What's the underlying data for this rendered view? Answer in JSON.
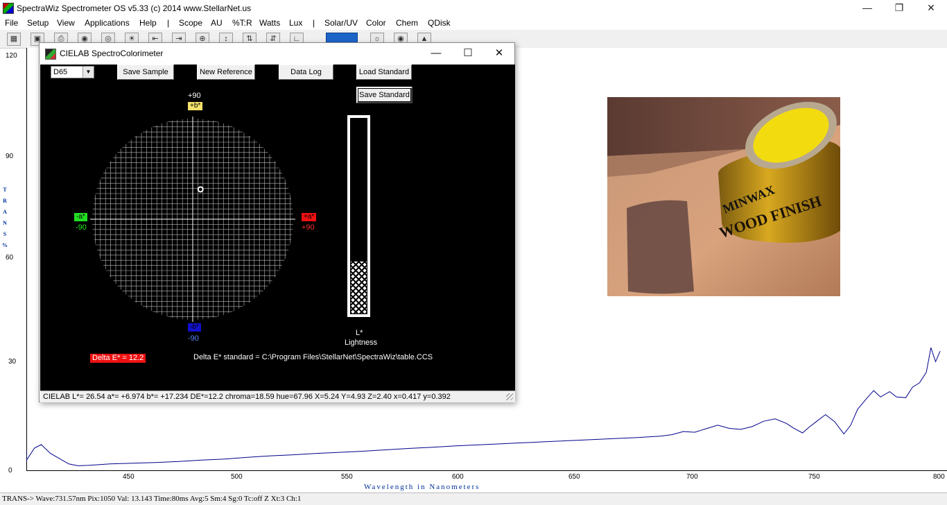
{
  "window": {
    "title": "SpectraWiz  Spectrometer OS v5.33 (c) 2014    www.StellarNet.us"
  },
  "menu": [
    "File",
    "Setup",
    "View",
    "Applications",
    "Help",
    "|",
    "Scope",
    "AU",
    "%T:R",
    "Watts",
    "Lux",
    "|",
    "Solar/UV",
    "Color",
    "Chem",
    "QDisk"
  ],
  "plot": {
    "y_ticks": [
      "120",
      "90",
      "60",
      "30",
      "0"
    ],
    "x_ticks": [
      "450",
      "500",
      "550",
      "600",
      "650",
      "700",
      "750",
      "800"
    ],
    "y_label_letters": [
      "T",
      "R",
      "A",
      "N",
      "S",
      "%"
    ],
    "x_label": "Wavelength  in  Nanometers",
    "line_color": "#00008b",
    "series": [
      [
        400,
        6
      ],
      [
        403,
        3
      ],
      [
        407,
        6.5
      ],
      [
        410,
        7.5
      ],
      [
        414,
        5
      ],
      [
        418,
        3.5
      ],
      [
        422,
        2
      ],
      [
        426,
        1.5
      ],
      [
        430,
        1.6
      ],
      [
        440,
        2
      ],
      [
        450,
        2.2
      ],
      [
        460,
        2.4
      ],
      [
        470,
        2.7
      ],
      [
        480,
        3.1
      ],
      [
        490,
        3.4
      ],
      [
        500,
        3.9
      ],
      [
        510,
        4.3
      ],
      [
        520,
        4.6
      ],
      [
        530,
        5
      ],
      [
        540,
        5.3
      ],
      [
        550,
        5.6
      ],
      [
        560,
        6
      ],
      [
        570,
        6.4
      ],
      [
        580,
        6.7
      ],
      [
        590,
        7.1
      ],
      [
        600,
        7.4
      ],
      [
        610,
        7.7
      ],
      [
        620,
        8
      ],
      [
        630,
        8.3
      ],
      [
        640,
        8.6
      ],
      [
        650,
        8.9
      ],
      [
        660,
        9.2
      ],
      [
        670,
        9.5
      ],
      [
        680,
        9.9
      ],
      [
        685,
        10.3
      ],
      [
        690,
        11.2
      ],
      [
        695,
        11
      ],
      [
        700,
        12
      ],
      [
        705,
        13
      ],
      [
        710,
        12.1
      ],
      [
        715,
        11.8
      ],
      [
        720,
        12.6
      ],
      [
        725,
        14.1
      ],
      [
        730,
        14.8
      ],
      [
        735,
        13.5
      ],
      [
        738,
        12.2
      ],
      [
        742,
        10.8
      ],
      [
        745,
        12.5
      ],
      [
        748,
        14
      ],
      [
        752,
        16
      ],
      [
        756,
        14
      ],
      [
        760,
        10.5
      ],
      [
        763,
        13
      ],
      [
        766,
        17.5
      ],
      [
        770,
        20.6
      ],
      [
        773,
        22.8
      ],
      [
        776,
        21
      ],
      [
        780,
        22.5
      ],
      [
        783,
        21
      ],
      [
        787,
        20.8
      ],
      [
        790,
        23.8
      ],
      [
        793,
        25
      ],
      [
        796,
        28
      ],
      [
        798,
        35
      ],
      [
        800,
        31
      ],
      [
        802,
        34
      ]
    ]
  },
  "status_bar": "TRANS->  Wave:731.57nm  Pix:1050  Val: 13.143  Time:80ms  Avg:5  Sm:4  Sg:0  Tc:off  Z  Xt:3  Ch:1",
  "dialog": {
    "title": "CIELAB SpectroColorimeter",
    "illuminant": "D65",
    "buttons": {
      "save_sample": "Save Sample",
      "new_reference": "New Reference",
      "data_log": "Data Log",
      "load_standard": "Load Standard",
      "save_standard": "Save Standard"
    },
    "axis_labels": {
      "plus_b_value": "+90",
      "plus_b": "+b*",
      "minus_a": "-a*",
      "minus_a_value": "-90",
      "plus_a": "+a*",
      "plus_a_value": "+90",
      "minus_b": "-b*",
      "minus_b_value": "-90"
    },
    "lightness_label_1": "L*",
    "lightness_label_2": "Lightness",
    "lightness_value": 26.54,
    "a_value": 6.974,
    "b_value": 17.234,
    "delta_e_badge": "Delta E* = 12.2",
    "delta_e_standard": "Delta E* standard = C:\\Program Files\\StellarNet\\SpectraWiz\\table.CCS",
    "status": "CIELAB L*= 26.54  a*= +6.974  b*= +17.234  DE*=12.2  chroma=18.59  hue=67.96  X=5.24  Y=4.93  Z=2.40  x=0.417  y=0.392"
  },
  "photo": {
    "can_text_1": "MINWAX",
    "can_text_2": "WOOD FINISH"
  }
}
